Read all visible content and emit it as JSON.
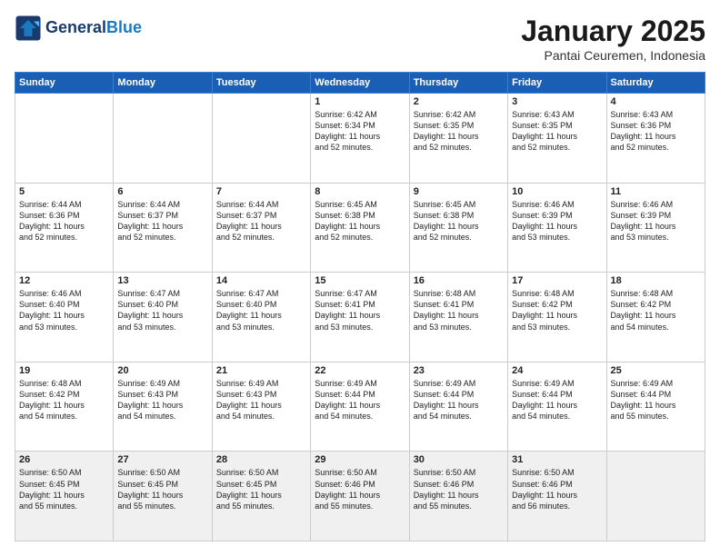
{
  "header": {
    "logo_line1": "General",
    "logo_line2": "Blue",
    "month": "January 2025",
    "location": "Pantai Ceuremen, Indonesia"
  },
  "weekdays": [
    "Sunday",
    "Monday",
    "Tuesday",
    "Wednesday",
    "Thursday",
    "Friday",
    "Saturday"
  ],
  "weeks": [
    [
      {
        "day": "",
        "info": ""
      },
      {
        "day": "",
        "info": ""
      },
      {
        "day": "",
        "info": ""
      },
      {
        "day": "1",
        "info": "Sunrise: 6:42 AM\nSunset: 6:34 PM\nDaylight: 11 hours\nand 52 minutes."
      },
      {
        "day": "2",
        "info": "Sunrise: 6:42 AM\nSunset: 6:35 PM\nDaylight: 11 hours\nand 52 minutes."
      },
      {
        "day": "3",
        "info": "Sunrise: 6:43 AM\nSunset: 6:35 PM\nDaylight: 11 hours\nand 52 minutes."
      },
      {
        "day": "4",
        "info": "Sunrise: 6:43 AM\nSunset: 6:36 PM\nDaylight: 11 hours\nand 52 minutes."
      }
    ],
    [
      {
        "day": "5",
        "info": "Sunrise: 6:44 AM\nSunset: 6:36 PM\nDaylight: 11 hours\nand 52 minutes."
      },
      {
        "day": "6",
        "info": "Sunrise: 6:44 AM\nSunset: 6:37 PM\nDaylight: 11 hours\nand 52 minutes."
      },
      {
        "day": "7",
        "info": "Sunrise: 6:44 AM\nSunset: 6:37 PM\nDaylight: 11 hours\nand 52 minutes."
      },
      {
        "day": "8",
        "info": "Sunrise: 6:45 AM\nSunset: 6:38 PM\nDaylight: 11 hours\nand 52 minutes."
      },
      {
        "day": "9",
        "info": "Sunrise: 6:45 AM\nSunset: 6:38 PM\nDaylight: 11 hours\nand 52 minutes."
      },
      {
        "day": "10",
        "info": "Sunrise: 6:46 AM\nSunset: 6:39 PM\nDaylight: 11 hours\nand 53 minutes."
      },
      {
        "day": "11",
        "info": "Sunrise: 6:46 AM\nSunset: 6:39 PM\nDaylight: 11 hours\nand 53 minutes."
      }
    ],
    [
      {
        "day": "12",
        "info": "Sunrise: 6:46 AM\nSunset: 6:40 PM\nDaylight: 11 hours\nand 53 minutes."
      },
      {
        "day": "13",
        "info": "Sunrise: 6:47 AM\nSunset: 6:40 PM\nDaylight: 11 hours\nand 53 minutes."
      },
      {
        "day": "14",
        "info": "Sunrise: 6:47 AM\nSunset: 6:40 PM\nDaylight: 11 hours\nand 53 minutes."
      },
      {
        "day": "15",
        "info": "Sunrise: 6:47 AM\nSunset: 6:41 PM\nDaylight: 11 hours\nand 53 minutes."
      },
      {
        "day": "16",
        "info": "Sunrise: 6:48 AM\nSunset: 6:41 PM\nDaylight: 11 hours\nand 53 minutes."
      },
      {
        "day": "17",
        "info": "Sunrise: 6:48 AM\nSunset: 6:42 PM\nDaylight: 11 hours\nand 53 minutes."
      },
      {
        "day": "18",
        "info": "Sunrise: 6:48 AM\nSunset: 6:42 PM\nDaylight: 11 hours\nand 54 minutes."
      }
    ],
    [
      {
        "day": "19",
        "info": "Sunrise: 6:48 AM\nSunset: 6:42 PM\nDaylight: 11 hours\nand 54 minutes."
      },
      {
        "day": "20",
        "info": "Sunrise: 6:49 AM\nSunset: 6:43 PM\nDaylight: 11 hours\nand 54 minutes."
      },
      {
        "day": "21",
        "info": "Sunrise: 6:49 AM\nSunset: 6:43 PM\nDaylight: 11 hours\nand 54 minutes."
      },
      {
        "day": "22",
        "info": "Sunrise: 6:49 AM\nSunset: 6:44 PM\nDaylight: 11 hours\nand 54 minutes."
      },
      {
        "day": "23",
        "info": "Sunrise: 6:49 AM\nSunset: 6:44 PM\nDaylight: 11 hours\nand 54 minutes."
      },
      {
        "day": "24",
        "info": "Sunrise: 6:49 AM\nSunset: 6:44 PM\nDaylight: 11 hours\nand 54 minutes."
      },
      {
        "day": "25",
        "info": "Sunrise: 6:49 AM\nSunset: 6:44 PM\nDaylight: 11 hours\nand 55 minutes."
      }
    ],
    [
      {
        "day": "26",
        "info": "Sunrise: 6:50 AM\nSunset: 6:45 PM\nDaylight: 11 hours\nand 55 minutes."
      },
      {
        "day": "27",
        "info": "Sunrise: 6:50 AM\nSunset: 6:45 PM\nDaylight: 11 hours\nand 55 minutes."
      },
      {
        "day": "28",
        "info": "Sunrise: 6:50 AM\nSunset: 6:45 PM\nDaylight: 11 hours\nand 55 minutes."
      },
      {
        "day": "29",
        "info": "Sunrise: 6:50 AM\nSunset: 6:46 PM\nDaylight: 11 hours\nand 55 minutes."
      },
      {
        "day": "30",
        "info": "Sunrise: 6:50 AM\nSunset: 6:46 PM\nDaylight: 11 hours\nand 55 minutes."
      },
      {
        "day": "31",
        "info": "Sunrise: 6:50 AM\nSunset: 6:46 PM\nDaylight: 11 hours\nand 56 minutes."
      },
      {
        "day": "",
        "info": ""
      }
    ]
  ]
}
